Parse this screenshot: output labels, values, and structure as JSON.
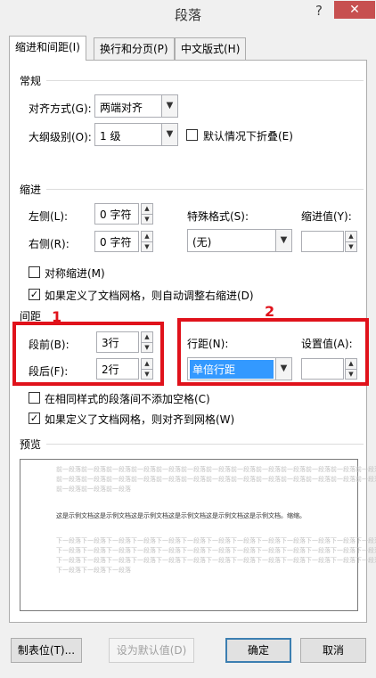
{
  "dialog": {
    "title": "段落",
    "help": "?",
    "close": "✕"
  },
  "tabs": [
    "缩进和间距(I)",
    "换行和分页(P)",
    "中文版式(H)"
  ],
  "general": {
    "header": "常规",
    "alignment_label": "对齐方式(G):",
    "alignment_value": "两端对齐",
    "outline_label": "大纲级别(O):",
    "outline_value": "1 级",
    "collapse_label": "默认情况下折叠(E)"
  },
  "indent": {
    "header": "缩进",
    "left_label": "左侧(L):",
    "left_value": "0 字符",
    "right_label": "右侧(R):",
    "right_value": "0 字符",
    "special_label": "特殊格式(S):",
    "special_value": "(无)",
    "by_label": "缩进值(Y):",
    "mirror_label": "对称缩进(M)",
    "auto_adjust_label": "如果定义了文档网格，则自动调整右缩进(D)"
  },
  "spacing": {
    "header": "间距",
    "before_label": "段前(B):",
    "before_value": "3行",
    "after_label": "段后(F):",
    "after_value": "2行",
    "line_label": "行距(N):",
    "line_value": "单倍行距",
    "at_label": "设置值(A):",
    "no_space_label": "在相同样式的段落间不添加空格(C)",
    "snap_label": "如果定义了文档网格，则对齐到网格(W)"
  },
  "annotations": {
    "one": "1",
    "two": "2"
  },
  "preview": {
    "header": "预览",
    "prev_line1": "前一段落前一段落前一段落前一段落前一段落前一段落前一段落前一段落前一段落前一段落前一段落前一段落前一段落",
    "prev_line2": "前一段落前一段落前一段落前一段落前一段落前一段落前一段落前一段落前一段落前一段落前一段落前一段落前一段落",
    "prev_line3": "前一段落前一段落前一段落",
    "sample": "这是示例文档这是示例文档这是示例文档这是示例文档这是示例文档这是示例文档。缩缩。",
    "next_line1": "下一段落下一段落下一段落下一段落下一段落下一段落下一段落下一段落下一段落下一段落下一段落下一段落下一段落",
    "next_line2": "下一段落下一段落下一段落下一段落下一段落下一段落下一段落下一段落下一段落下一段落下一段落下一段落下一段落",
    "next_line3": "下一段落下一段落下一段落下一段落下一段落下一段落下一段落下一段落下一段落下一段落下一段落下一段落下一段落",
    "next_line4": "下一段落下一段落下一段落"
  },
  "buttons": {
    "tabs": "制表位(T)...",
    "default": "设为默认值(D)",
    "ok": "确定",
    "cancel": "取消"
  }
}
